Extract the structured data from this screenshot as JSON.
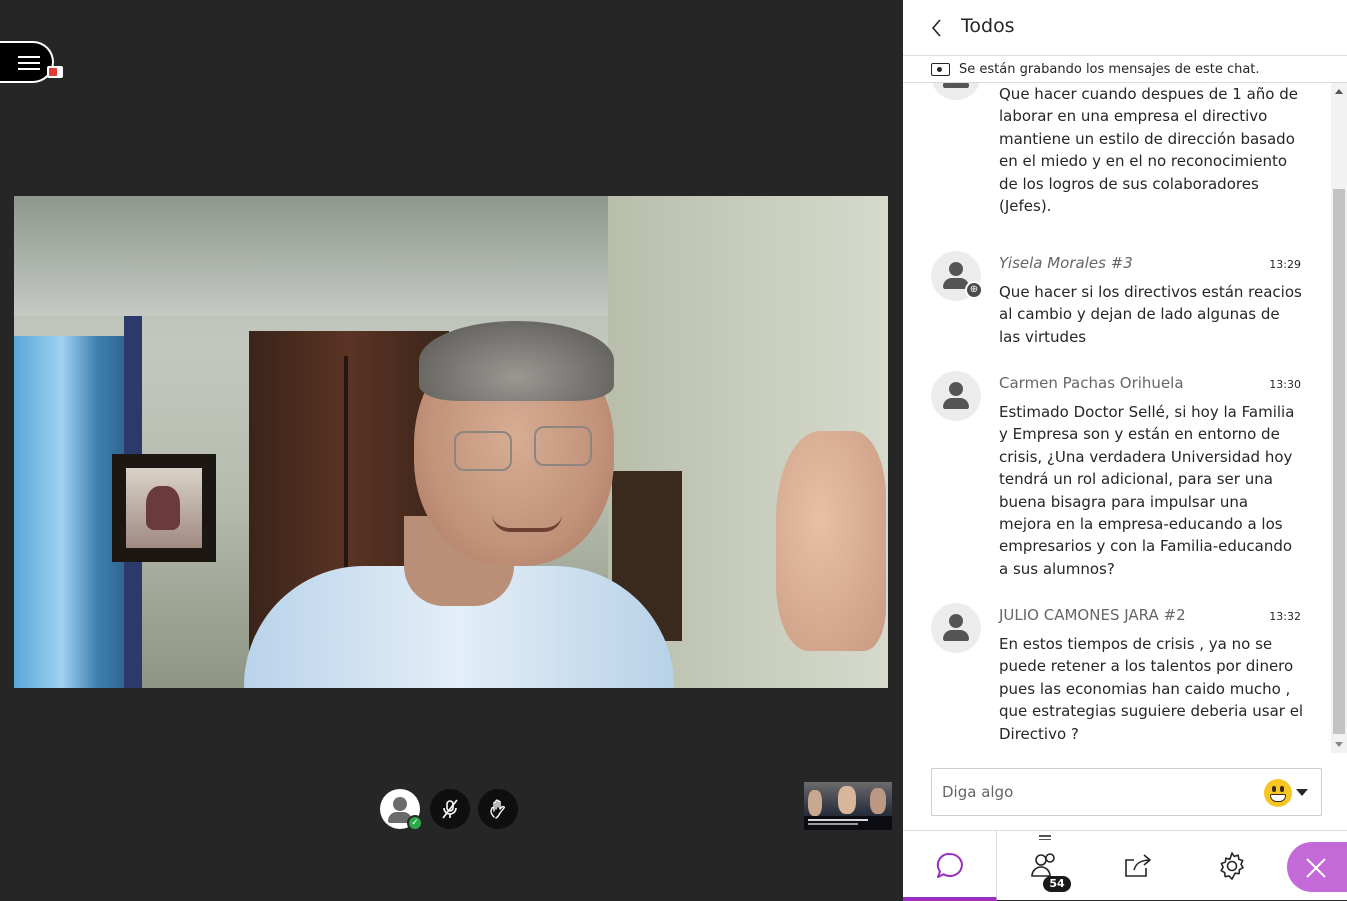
{
  "panel": {
    "title": "Todos",
    "recording_notice": "Se están grabando los mensajes de este chat."
  },
  "chat": {
    "messages": [
      {
        "author": "",
        "time": "",
        "text": "Que hacer cuando despues de 1 año de laborar en una empresa el directivo mantiene un estilo de dirección basado en el miedo y en el no reconocimiento de los logros de sus colaboradores (Jefes)."
      },
      {
        "author": "Yisela Morales #3",
        "time": "13:29",
        "text": "Que hacer si los directivos están reacios al cambio y dejan de lado algunas de las  virtudes"
      },
      {
        "author": "Carmen Pachas Orihuela",
        "time": "13:30",
        "text": "Estimado Doctor Sellé, si hoy la Familia y Empresa son y están en entorno de crisis, ¿Una verdadera Universidad hoy tendrá un rol adicional, para ser una buena bisagra para impulsar una mejora en la empresa-educando a los empresarios y con la Familia-educando a sus alumnos?"
      },
      {
        "author": "JULIO CAMONES JARA #2",
        "time": "13:32",
        "text": "En estos tiempos de crisis , ya no se puede retener a los talentos por dinero pues las economias han caido mucho , que estrategias suguiere deberia usar el Directivo ?"
      }
    ]
  },
  "composer": {
    "placeholder": "Diga algo"
  },
  "tabs": {
    "attendee_count": "54"
  },
  "colors": {
    "accent": "#9c2fc0",
    "close_button": "#c36ad8",
    "stage_background": "#262626"
  }
}
